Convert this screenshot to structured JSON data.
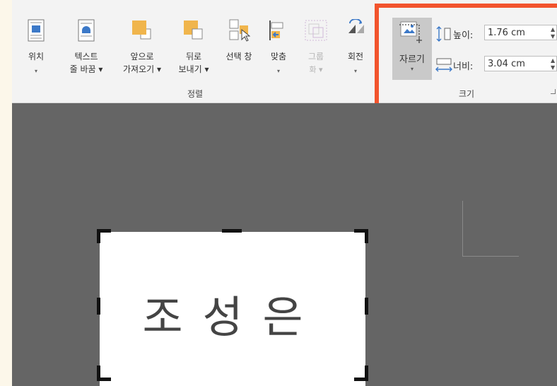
{
  "ribbon": {
    "arrange_group_label": "정렬",
    "size_group_label": "크기",
    "buttons": {
      "position": {
        "label": "위치",
        "caret": "▾"
      },
      "wrap_text": {
        "label_line1": "텍스트",
        "label_line2": "줄 바꿈 ▾"
      },
      "bring_forward": {
        "label_line1": "앞으로",
        "label_line2": "가져오기 ▾"
      },
      "send_backward": {
        "label_line1": "뒤로",
        "label_line2": "보내기 ▾"
      },
      "selection_pane": {
        "label": "선택 창"
      },
      "align": {
        "label": "맞춤",
        "caret": "▾"
      },
      "group": {
        "label_line1": "그룹",
        "label_line2": "화 ▾"
      },
      "rotate": {
        "label": "회전",
        "caret": "▾"
      },
      "crop": {
        "label": "자르기",
        "caret": "▾"
      }
    },
    "size": {
      "height_label": "높이:",
      "height_value": "1.76 cm",
      "width_label": "너비:",
      "width_value": "3.04 cm"
    }
  },
  "canvas": {
    "signature_text": "조성은"
  },
  "colors": {
    "highlight": "#f2542d",
    "ribbon_bg": "#f3f3f3",
    "document_bg": "#656565"
  }
}
